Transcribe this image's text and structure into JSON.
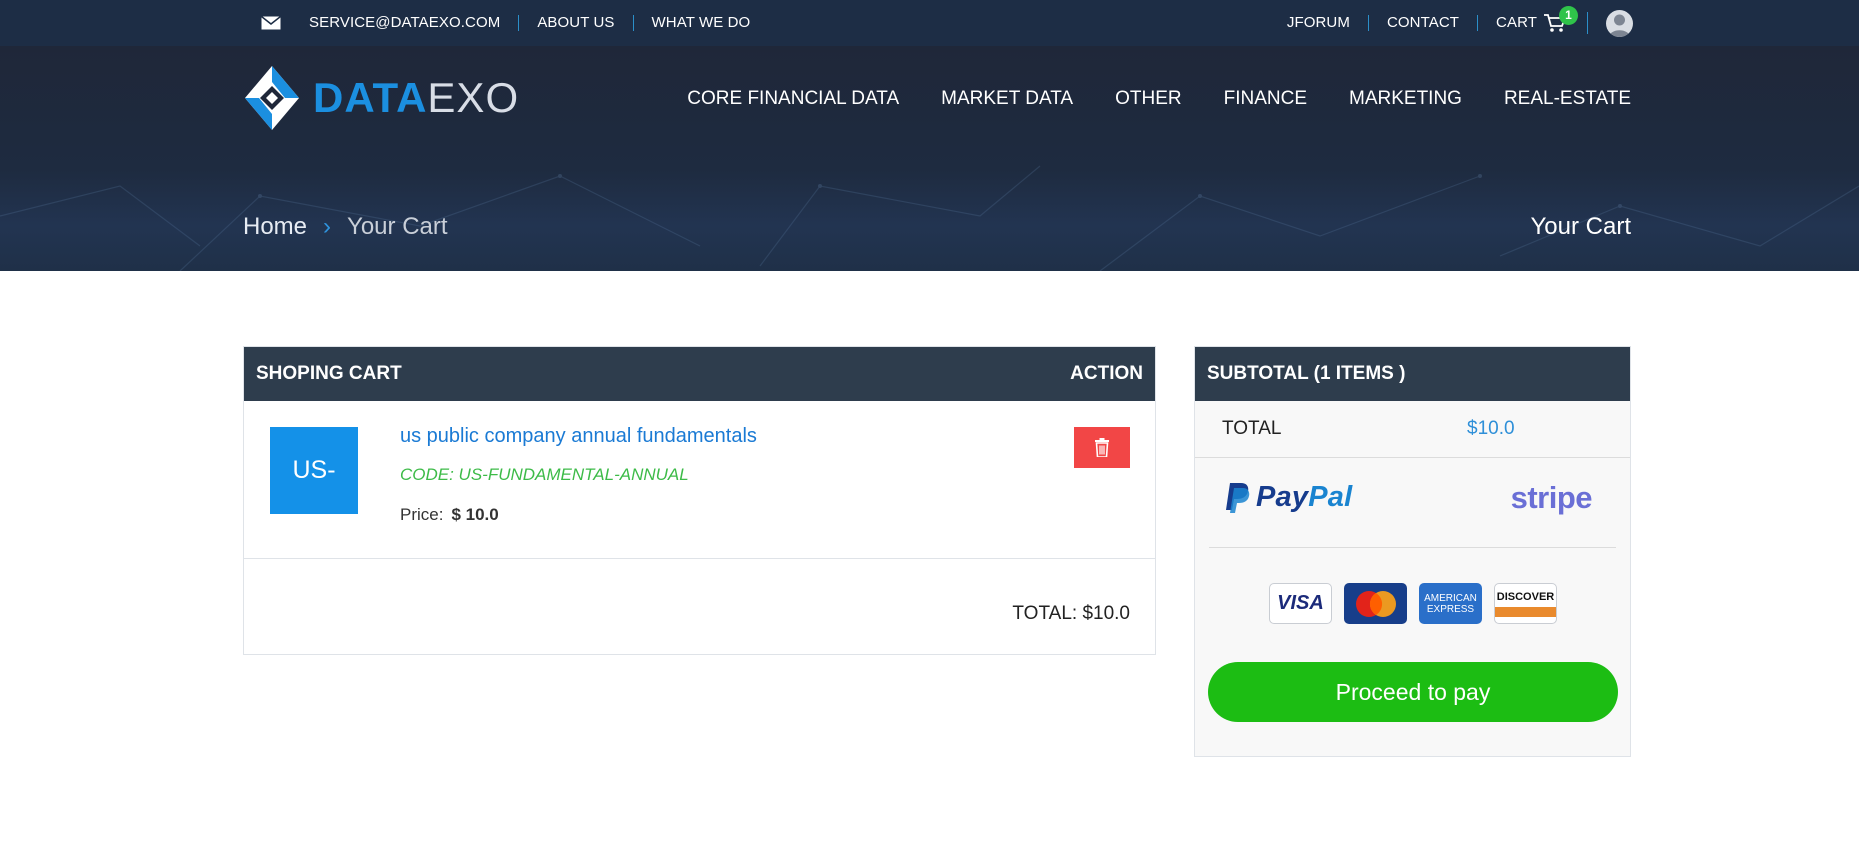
{
  "topbar": {
    "email": "SERVICE@DATAEXO.COM",
    "about": "ABOUT US",
    "what": "WHAT WE DO",
    "jforum": "JFORUM",
    "contact": "CONTACT",
    "cart": "CART",
    "cart_count": "1"
  },
  "logo": {
    "part1": "DATA",
    "part2": "EXO"
  },
  "nav": [
    "CORE FINANCIAL DATA",
    "MARKET DATA",
    "OTHER",
    "FINANCE",
    "MARKETING",
    "REAL-ESTATE"
  ],
  "breadcrumb": {
    "home": "Home",
    "current": "Your Cart"
  },
  "page_title": "Your Cart",
  "cart": {
    "header_left": "SHOPING CART",
    "header_right": "ACTION",
    "item": {
      "thumb": "US-",
      "title": "us public company annual fundamentals",
      "code": "CODE: US-FUNDAMENTAL-ANNUAL",
      "price_label": "Price:",
      "price_value": "$ 10.0"
    },
    "total": "TOTAL: $10.0"
  },
  "subtotal": {
    "header": "SUBTOTAL (1 ITEMS )",
    "total_label": "TOTAL",
    "total_value": "$10.0",
    "paypal_a": "Pay",
    "paypal_b": "Pal",
    "stripe": "stripe",
    "cards": {
      "visa": "VISA",
      "amex_1": "AMERICAN",
      "amex_2": "EXPRESS",
      "discover": "DISCOVER"
    },
    "pay_button": "Proceed to pay"
  },
  "colors": {
    "topbar": "#1d2d45",
    "accent": "#1b8fe0",
    "pay_button": "#1cbd13",
    "delete": "#f24646",
    "table_head": "#2e3d4d"
  },
  "icons": [
    "mail-icon",
    "cart-icon",
    "avatar-icon",
    "chevron-right-icon",
    "trash-icon",
    "paypal-icon"
  ]
}
